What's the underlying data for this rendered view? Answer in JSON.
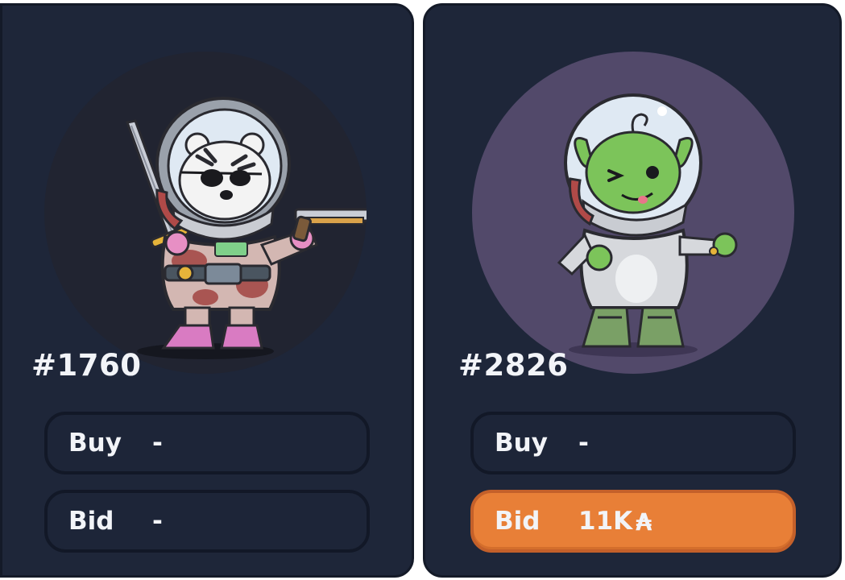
{
  "cards": [
    {
      "id": "#1760",
      "art_bg": "#212431",
      "buy": {
        "label": "Buy",
        "value": "-"
      },
      "bid": {
        "label": "Bid",
        "value": "-"
      }
    },
    {
      "id": "#2826",
      "art_bg": "#52496a",
      "buy": {
        "label": "Buy",
        "value": "-"
      },
      "bid": {
        "label": "Bid",
        "value": "11K",
        "currency_icon": "algo-icon"
      }
    }
  ],
  "colors": {
    "card_bg": "#1e2639",
    "card_border": "#141a28",
    "button_bg": "#1d2538",
    "active_button_bg": "#e87f37",
    "text": "#f2f4f8"
  }
}
